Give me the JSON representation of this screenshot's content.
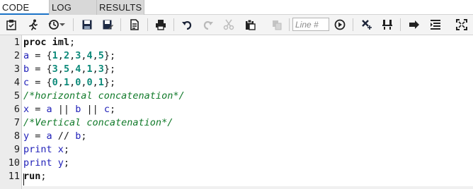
{
  "tabs": [
    {
      "label": "CODE",
      "active": true
    },
    {
      "label": "LOG",
      "active": false
    },
    {
      "label": "RESULTS",
      "active": false
    }
  ],
  "toolbar": {
    "line_placeholder": "Line #",
    "icons": [
      "clipboard-icon",
      "running-person-icon",
      "history-icon",
      "dropdown-arrow-icon",
      "save-icon",
      "save-as-icon",
      "document-icon",
      "print-icon",
      "undo-icon",
      "redo-icon",
      "cut-icon",
      "paste-icon",
      "copy-icon",
      "go-arrow-icon",
      "clear-icon",
      "format-code-icon",
      "submit-icon",
      "list-icon",
      "maximize-icon"
    ]
  },
  "colors": {
    "keyword": "#0d0d8b",
    "identifier": "#1f1fb8",
    "number": "#0d8a7a",
    "comment": "#117a2a",
    "accent": "#1a73c7"
  },
  "editor": {
    "line_numbers": [
      "1",
      "2",
      "3",
      "4",
      "5",
      "6",
      "7",
      "8",
      "9",
      "10",
      "11"
    ],
    "lines": [
      [
        {
          "t": "proc iml",
          "c": "kw2"
        },
        {
          "t": ";",
          "c": "op"
        }
      ],
      [
        {
          "t": "a",
          "c": "id"
        },
        {
          "t": " = {",
          "c": "op"
        },
        {
          "t": "1",
          "c": "num"
        },
        {
          "t": ",",
          "c": "op"
        },
        {
          "t": "2",
          "c": "num"
        },
        {
          "t": ",",
          "c": "op"
        },
        {
          "t": "3",
          "c": "num"
        },
        {
          "t": ",",
          "c": "op"
        },
        {
          "t": "4",
          "c": "num"
        },
        {
          "t": ",",
          "c": "op"
        },
        {
          "t": "5",
          "c": "num"
        },
        {
          "t": "};",
          "c": "op"
        }
      ],
      [
        {
          "t": "b",
          "c": "id"
        },
        {
          "t": " = {",
          "c": "op"
        },
        {
          "t": "3",
          "c": "num"
        },
        {
          "t": ",",
          "c": "op"
        },
        {
          "t": "5",
          "c": "num"
        },
        {
          "t": ",",
          "c": "op"
        },
        {
          "t": "4",
          "c": "num"
        },
        {
          "t": ",",
          "c": "op"
        },
        {
          "t": "1",
          "c": "num"
        },
        {
          "t": ",",
          "c": "op"
        },
        {
          "t": "3",
          "c": "num"
        },
        {
          "t": "};",
          "c": "op"
        }
      ],
      [
        {
          "t": "c",
          "c": "id"
        },
        {
          "t": " = {",
          "c": "op"
        },
        {
          "t": "0",
          "c": "num"
        },
        {
          "t": ",",
          "c": "op"
        },
        {
          "t": "1",
          "c": "num"
        },
        {
          "t": ",",
          "c": "op"
        },
        {
          "t": "0",
          "c": "num"
        },
        {
          "t": ",",
          "c": "op"
        },
        {
          "t": "0",
          "c": "num"
        },
        {
          "t": ",",
          "c": "op"
        },
        {
          "t": "1",
          "c": "num"
        },
        {
          "t": "};",
          "c": "op"
        }
      ],
      [
        {
          "t": "/*horizontal concatenation*/",
          "c": "cmt"
        }
      ],
      [
        {
          "t": "x",
          "c": "id"
        },
        {
          "t": " = ",
          "c": "op"
        },
        {
          "t": "a",
          "c": "id"
        },
        {
          "t": " || ",
          "c": "op"
        },
        {
          "t": "b",
          "c": "id"
        },
        {
          "t": " || ",
          "c": "op"
        },
        {
          "t": "c",
          "c": "id"
        },
        {
          "t": ";",
          "c": "op"
        }
      ],
      [
        {
          "t": "/*Vertical concatenation*/",
          "c": "cmt"
        }
      ],
      [
        {
          "t": "y",
          "c": "id"
        },
        {
          "t": " = ",
          "c": "op"
        },
        {
          "t": "a",
          "c": "id"
        },
        {
          "t": " // ",
          "c": "op"
        },
        {
          "t": "b",
          "c": "id"
        },
        {
          "t": ";",
          "c": "op"
        }
      ],
      [
        {
          "t": "print",
          "c": "id"
        },
        {
          "t": " ",
          "c": "op"
        },
        {
          "t": "x",
          "c": "id"
        },
        {
          "t": ";",
          "c": "op"
        }
      ],
      [
        {
          "t": "print",
          "c": "id"
        },
        {
          "t": " ",
          "c": "op"
        },
        {
          "t": "y",
          "c": "id"
        },
        {
          "t": ";",
          "c": "op"
        }
      ],
      [
        {
          "t": "run",
          "c": "kw2"
        },
        {
          "t": ";",
          "c": "op"
        }
      ]
    ]
  }
}
